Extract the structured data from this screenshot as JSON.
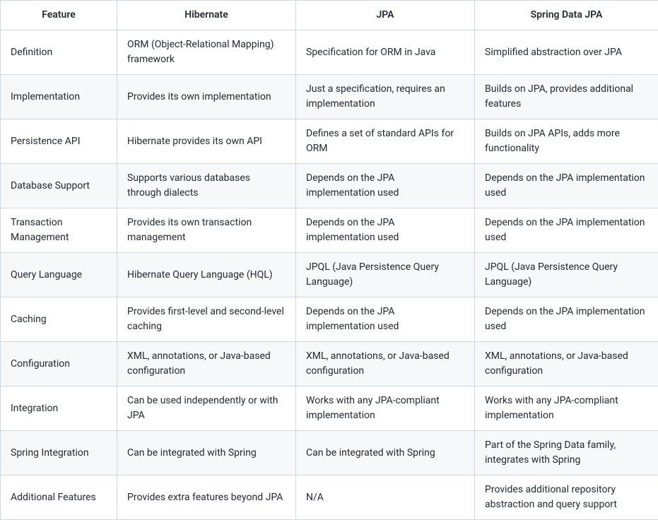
{
  "table": {
    "headers": [
      "Feature",
      "Hibernate",
      "JPA",
      "Spring Data JPA"
    ],
    "rows": [
      {
        "feature": "Definition",
        "hibernate": "ORM (Object-Relational Mapping) framework",
        "jpa": "Specification for ORM in Java",
        "springdata": "Simplified abstraction over JPA"
      },
      {
        "feature": "Implementation",
        "hibernate": "Provides its own implementation",
        "jpa": "Just a specification, requires an implementation",
        "springdata": "Builds on JPA, provides additional features"
      },
      {
        "feature": "Persistence API",
        "hibernate": "Hibernate provides its own API",
        "jpa": "Defines a set of standard APIs for ORM",
        "springdata": "Builds on JPA APIs, adds more functionality"
      },
      {
        "feature": "Database Support",
        "hibernate": "Supports various databases through dialects",
        "jpa": "Depends on the JPA implementation used",
        "springdata": "Depends on the JPA implementation used"
      },
      {
        "feature": "Transaction Management",
        "hibernate": "Provides its own transaction management",
        "jpa": "Depends on the JPA implementation used",
        "springdata": "Depends on the JPA implementation used"
      },
      {
        "feature": "Query Language",
        "hibernate": "Hibernate Query Language (HQL)",
        "jpa": "JPQL (Java Persistence Query Language)",
        "springdata": "JPQL (Java Persistence Query Language)"
      },
      {
        "feature": "Caching",
        "hibernate": "Provides first-level and second-level caching",
        "jpa": "Depends on the JPA implementation used",
        "springdata": "Depends on the JPA implementation used"
      },
      {
        "feature": "Configuration",
        "hibernate": "XML, annotations, or Java-based configuration",
        "jpa": "XML, annotations, or Java-based configuration",
        "springdata": "XML, annotations, or Java-based configuration"
      },
      {
        "feature": "Integration",
        "hibernate": "Can be used independently or with JPA",
        "jpa": "Works with any JPA-compliant implementation",
        "springdata": "Works with any JPA-compliant implementation"
      },
      {
        "feature": "Spring Integration",
        "hibernate": "Can be integrated with Spring",
        "jpa": "Can be integrated with Spring",
        "springdata": "Part of the Spring Data family, integrates with Spring"
      },
      {
        "feature": "Additional Features",
        "hibernate": "Provides extra features beyond JPA",
        "jpa": "N/A",
        "springdata": "Provides additional repository abstraction and query support"
      }
    ]
  }
}
